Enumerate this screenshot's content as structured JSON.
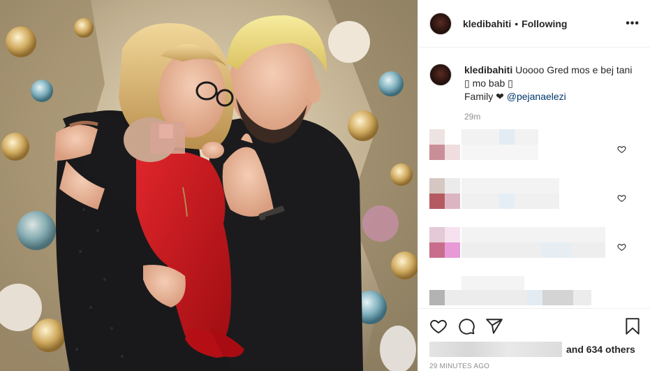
{
  "post": {
    "username": "kledibahiti",
    "separator": "•",
    "follow_status": "Following",
    "more_label": "•••"
  },
  "caption": {
    "username": "kledibahiti",
    "text_line1": "Uoooo Gred mos e bej tani",
    "text_line2": "▯ mo bab ▯",
    "text_line3_prefix": "Family ❤ ",
    "mention": "@pejanaelezi",
    "time": "29m"
  },
  "likes": {
    "others_text": "and 634 others"
  },
  "timestamp": "29 MINUTES AGO",
  "icons": {
    "like": "heart-outline-icon",
    "comment": "speech-bubble-icon",
    "share": "paper-plane-icon",
    "save": "bookmark-icon",
    "more": "ellipsis-icon"
  },
  "colors": {
    "text": "#262626",
    "secondary": "#8e8e8e",
    "mention": "#00376b",
    "border": "#efefef",
    "jacket_red": "#c4141a",
    "shirt_black": "#1b1b1d"
  }
}
